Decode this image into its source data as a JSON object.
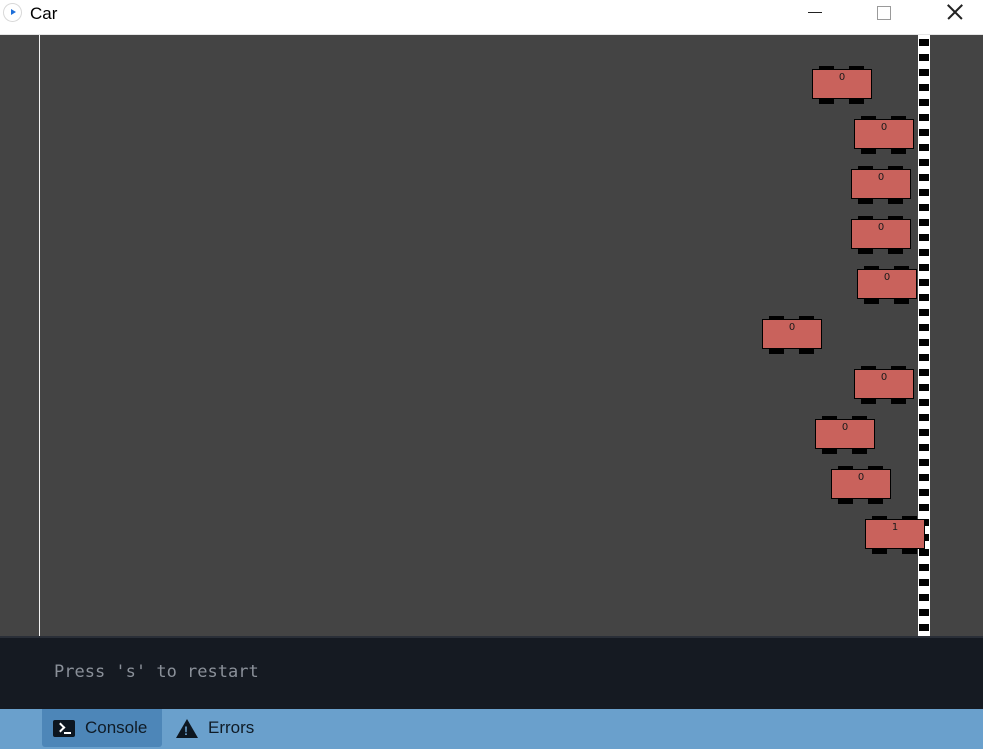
{
  "window": {
    "title": "Car"
  },
  "track": {
    "background": "#444444",
    "car_color": "#c9625c",
    "cars": [
      {
        "label": "0"
      },
      {
        "label": "0"
      },
      {
        "label": "0"
      },
      {
        "label": "0"
      },
      {
        "label": "0"
      },
      {
        "label": "0"
      },
      {
        "label": "0"
      },
      {
        "label": "0"
      },
      {
        "label": "0"
      },
      {
        "label": "1"
      }
    ]
  },
  "console": {
    "message": "Press 's' to restart"
  },
  "bottom_tabs": [
    {
      "label": "Console",
      "icon": "terminal-icon",
      "active": true
    },
    {
      "label": "Errors",
      "icon": "warning-icon",
      "active": false
    }
  ]
}
